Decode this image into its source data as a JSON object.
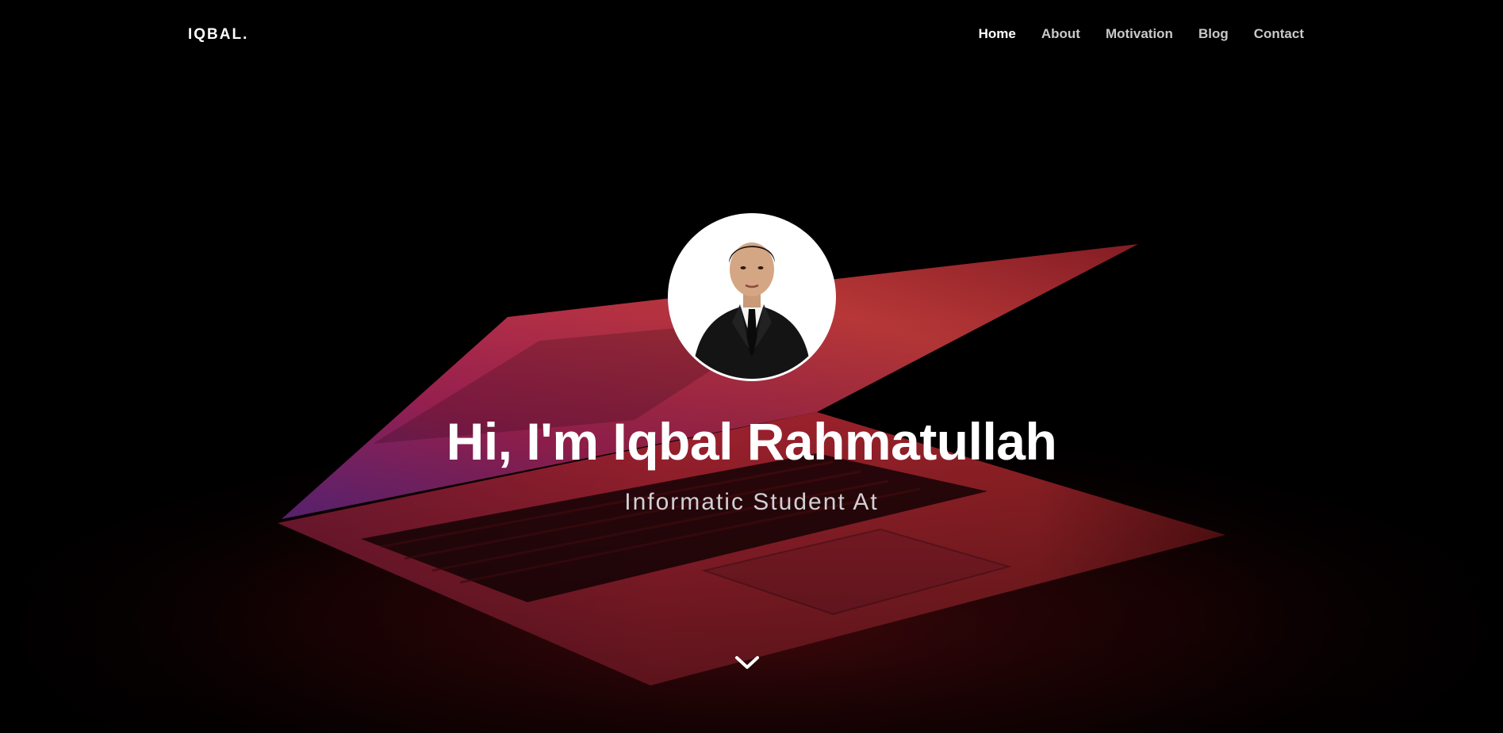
{
  "brand": "IQBAL.",
  "nav": {
    "items": [
      {
        "label": "Home",
        "active": true
      },
      {
        "label": "About",
        "active": false
      },
      {
        "label": "Motivation",
        "active": false
      },
      {
        "label": "Blog",
        "active": false
      },
      {
        "label": "Contact",
        "active": false
      }
    ]
  },
  "hero": {
    "title": "Hi, I'm Iqbal Rahmatullah",
    "subtitle": "Informatic Student At",
    "scroll_icon": "chevron-down-icon",
    "background": "laptop-photo",
    "avatar": "profile-photo"
  },
  "colors": {
    "background": "#000000",
    "text": "#ffffff",
    "nav_inactive": "#c9c9c9",
    "accent_red": "#b3262c",
    "accent_magenta": "#9a2a6a"
  }
}
